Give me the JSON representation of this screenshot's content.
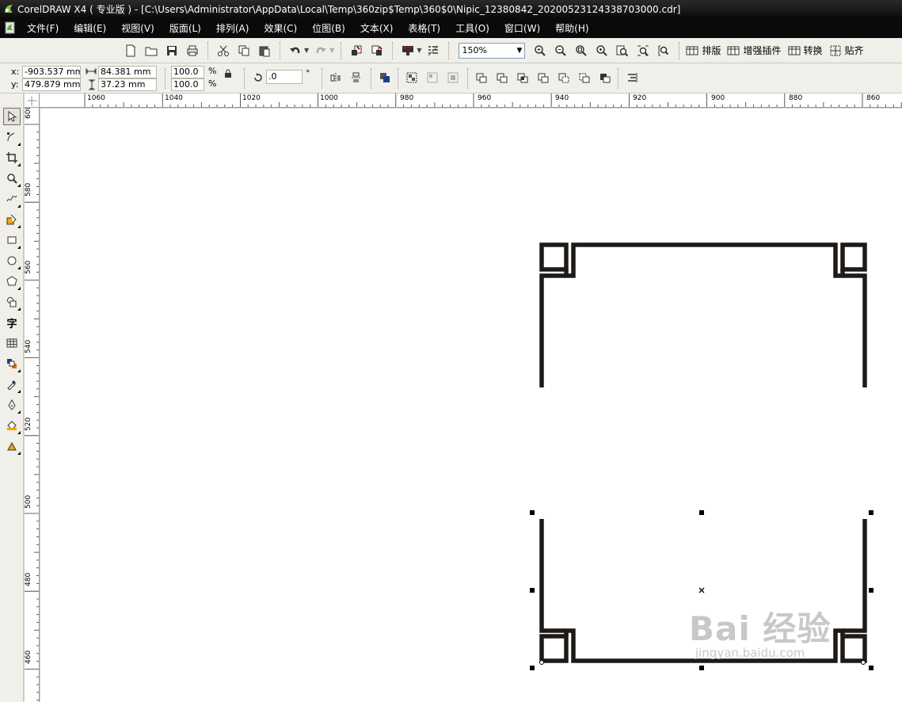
{
  "window": {
    "title": "CorelDRAW X4 ( 专业版 ) - [C:\\Users\\Administrator\\AppData\\Local\\Temp\\360zip$Temp\\360$0\\Nipic_12380842_20200523124338703000.cdr]"
  },
  "menu": {
    "items": [
      "文件(F)",
      "编辑(E)",
      "视图(V)",
      "版面(L)",
      "排列(A)",
      "效果(C)",
      "位图(B)",
      "文本(X)",
      "表格(T)",
      "工具(O)",
      "窗口(W)",
      "帮助(H)"
    ]
  },
  "toolbar": {
    "zoom_value": "150%",
    "layout_label": "排版",
    "plugin_label": "增强插件",
    "convert_label": "转换",
    "snap_label": "贴齐"
  },
  "property_bar": {
    "x_label": "x:",
    "y_label": "y:",
    "x_value": "-903.537 mm",
    "y_value": "479.879 mm",
    "width_value": "84.381 mm",
    "height_value": "37.23 mm",
    "scale_w": "100.0",
    "scale_h": "100.0",
    "percent_sign": "%",
    "rotation_value": ".0",
    "degree_sign": "°"
  },
  "ruler": {
    "h_labels": [
      "1060",
      "1040",
      "1020",
      "1000",
      "980",
      "960",
      "940",
      "920",
      "900",
      "880",
      "860"
    ],
    "v_labels": [
      "600",
      "580",
      "560",
      "540",
      "520",
      "500",
      "480",
      "460"
    ]
  },
  "watermark": {
    "main": "Bai 经验",
    "sub": "jingyan.baidu.com"
  },
  "colors": {
    "frame_stroke": "#1e1a17",
    "menubar_bg": "#0a0a0a",
    "toolbar_bg": "#f0efea"
  }
}
